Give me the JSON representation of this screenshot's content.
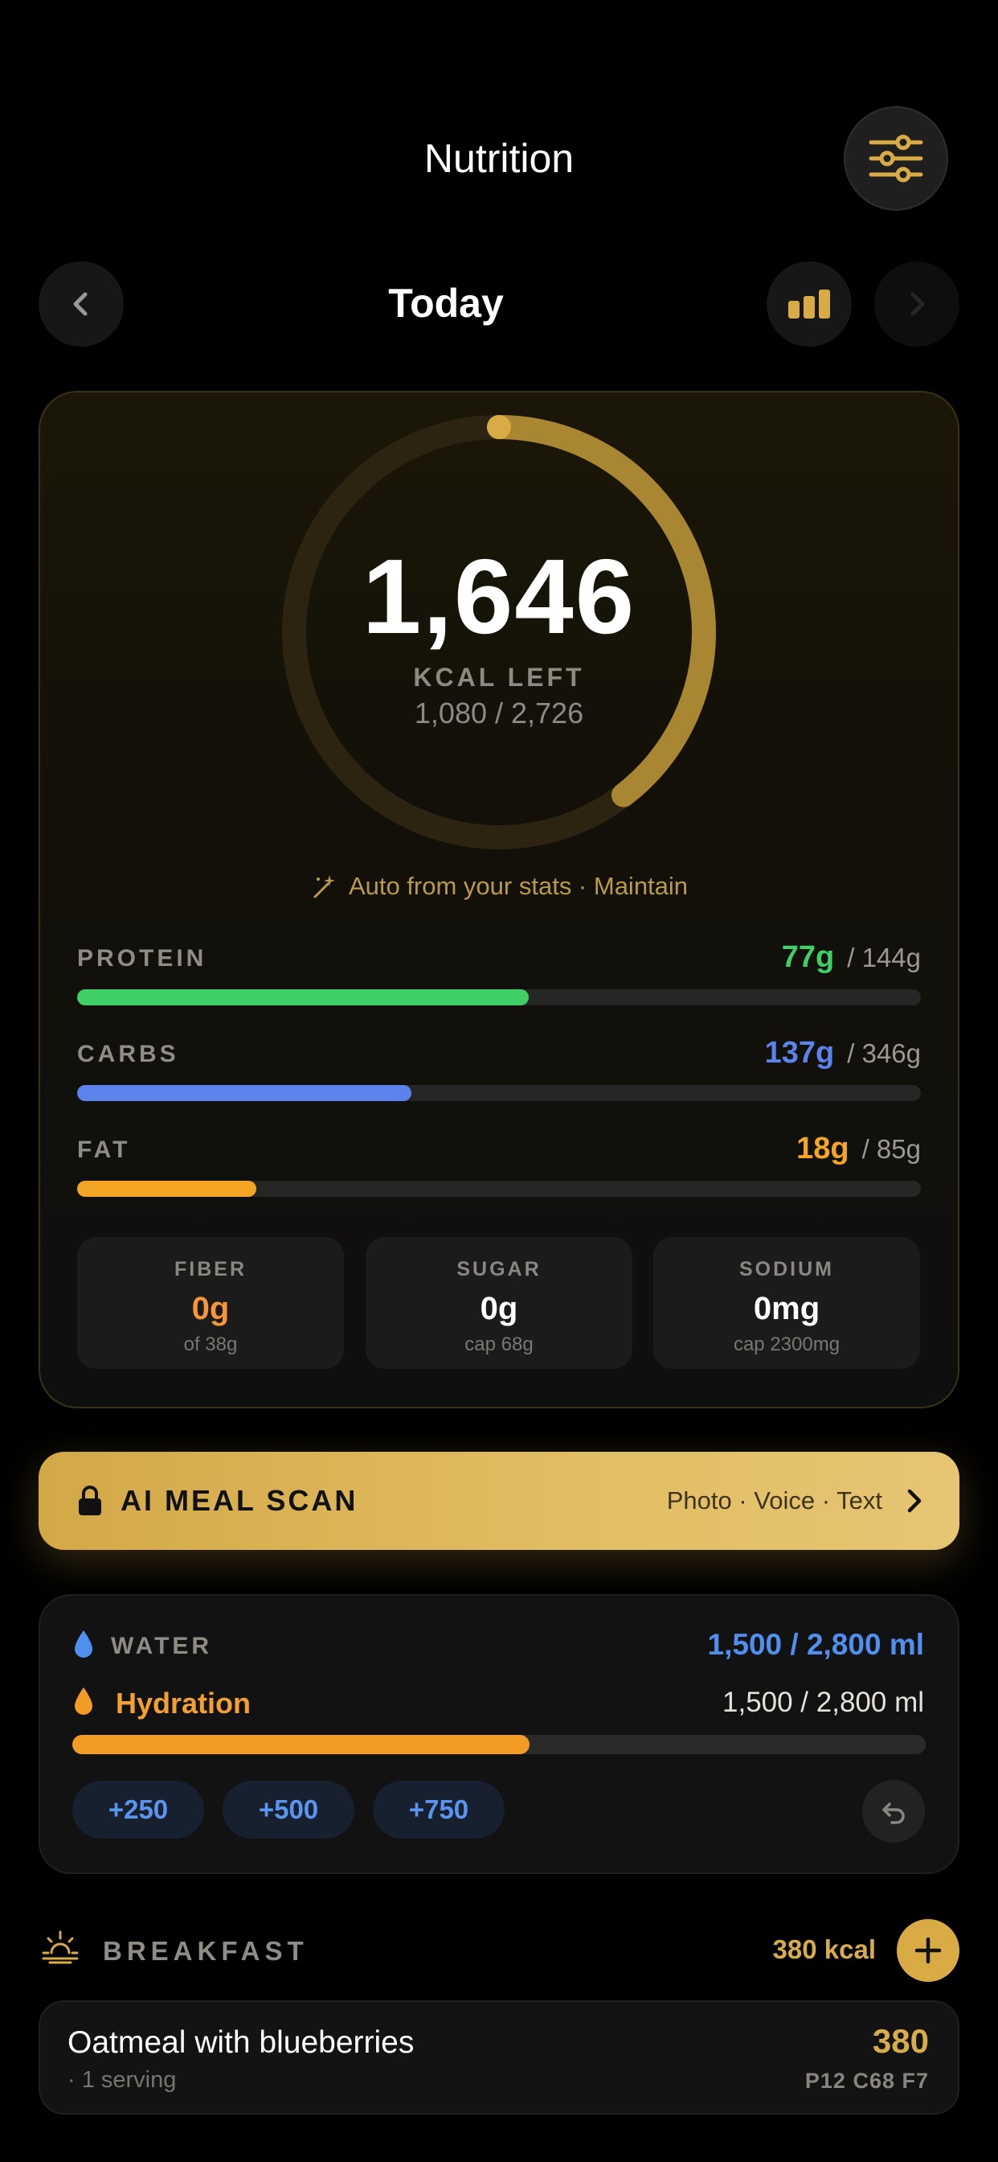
{
  "header": {
    "title": "Nutrition"
  },
  "day_nav": {
    "label": "Today"
  },
  "summary": {
    "kcal_left": "1,646",
    "kcal_label": "KCAL LEFT",
    "kcal_consumed_of_goal": "1,080 / 2,726",
    "progress_fraction": 0.396,
    "auto_note": "Auto from your stats · Maintain",
    "macros": [
      {
        "name": "PROTEIN",
        "current": "77g",
        "total": "/ 144g",
        "fraction": 0.535,
        "color": "#3fcf66"
      },
      {
        "name": "CARBS",
        "current": "137g",
        "total": "/ 346g",
        "fraction": 0.396,
        "color": "#5c82ec"
      },
      {
        "name": "FAT",
        "current": "18g",
        "total": "/ 85g",
        "fraction": 0.212,
        "color": "#f5a524"
      }
    ],
    "mini": [
      {
        "title": "FIBER",
        "value": "0g",
        "sub": "of 38g",
        "color": "#f5963a"
      },
      {
        "title": "SUGAR",
        "value": "0g",
        "sub": "cap 68g",
        "color": "#ffffff"
      },
      {
        "title": "SODIUM",
        "value": "0mg",
        "sub": "cap 2300mg",
        "color": "#ffffff"
      }
    ]
  },
  "ai_scan": {
    "title": "AI MEAL SCAN",
    "options": "Photo · Voice · Text"
  },
  "water": {
    "title": "WATER",
    "total": "1,500 / 2,800 ml",
    "hydration_label": "Hydration",
    "hydration_total": "1,500 / 2,800 ml",
    "fraction": 0.536,
    "quick_add": [
      "+250",
      "+500",
      "+750"
    ]
  },
  "breakfast": {
    "title": "BREAKFAST",
    "kcal": "380 kcal",
    "items": [
      {
        "name": "Oatmeal with blueberries",
        "serving": "· 1 serving",
        "kcal": "380",
        "macros": "P12 C68 F7"
      }
    ]
  },
  "colors": {
    "accent": "#d8ab45",
    "water": "#4f90ef",
    "hydration": "#f39c25"
  }
}
